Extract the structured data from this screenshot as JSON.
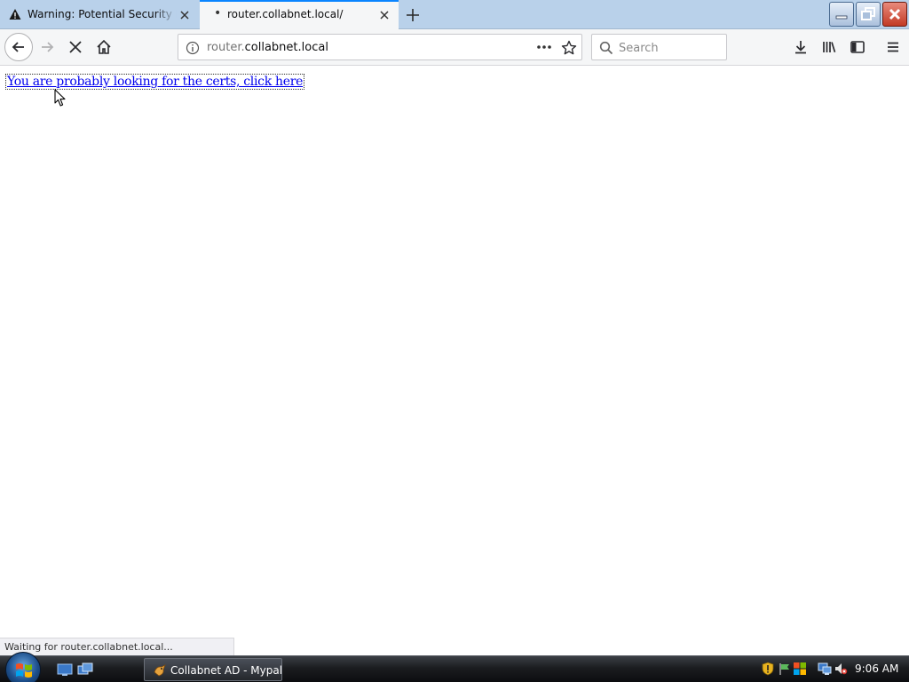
{
  "tabs": [
    {
      "title": "Warning: Potential Security Risk Ahead",
      "icon": "warning-icon",
      "active": false
    },
    {
      "title": "router.collabnet.local/",
      "icon": "loading-dot-icon",
      "active": true
    }
  ],
  "urlbar": {
    "host_dim": "router.",
    "host_main": "collabnet.local"
  },
  "search": {
    "placeholder": "Search"
  },
  "page": {
    "link_text": "You are probably looking for the certs, click here"
  },
  "status_bar": {
    "text": "Waiting for router.collabnet.local..."
  },
  "taskbar": {
    "task_label": "Collabnet AD - Mypal",
    "clock": "9:06 AM"
  },
  "colors": {
    "tab_accent": "#0a84ff",
    "link": "#0000ee",
    "close_button": "#c23a24"
  }
}
